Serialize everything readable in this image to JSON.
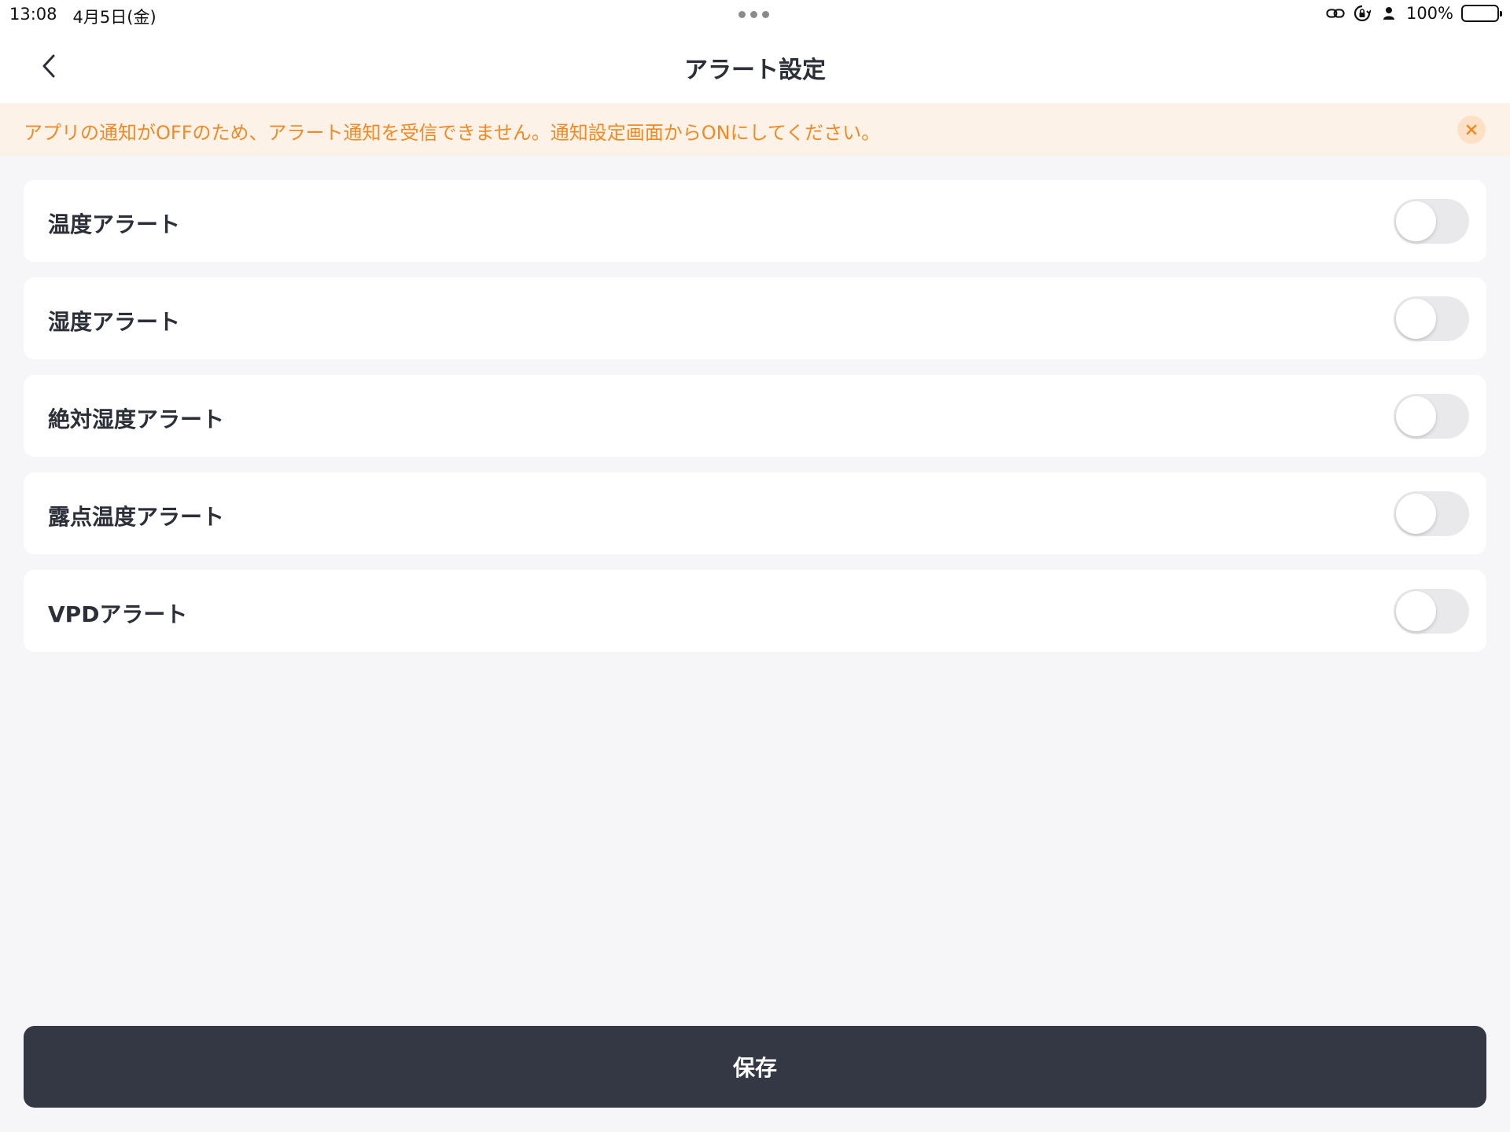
{
  "status_bar": {
    "time": "13:08",
    "date": "4月5日(金)",
    "battery_percent": "100%",
    "battery_level": 1.0,
    "icons": [
      "link-icon",
      "rotation-lock-icon",
      "person-icon",
      "battery-icon"
    ]
  },
  "nav": {
    "title": "アラート設定",
    "back_icon": "chevron-left-icon"
  },
  "banner": {
    "message": "アプリの通知がOFFのため、アラート通知を受信できません。通知設定画面からONにしてください。",
    "close_icon": "close-icon",
    "text_color": "#f08a24",
    "background": "#fdf2e8"
  },
  "alerts": [
    {
      "label": "温度アラート",
      "enabled": false
    },
    {
      "label": "湿度アラート",
      "enabled": false
    },
    {
      "label": "絶対湿度アラート",
      "enabled": false
    },
    {
      "label": "露点温度アラート",
      "enabled": false
    },
    {
      "label": "VPDアラート",
      "enabled": false
    }
  ],
  "footer": {
    "save_label": "保存",
    "save_color": "#343844"
  }
}
